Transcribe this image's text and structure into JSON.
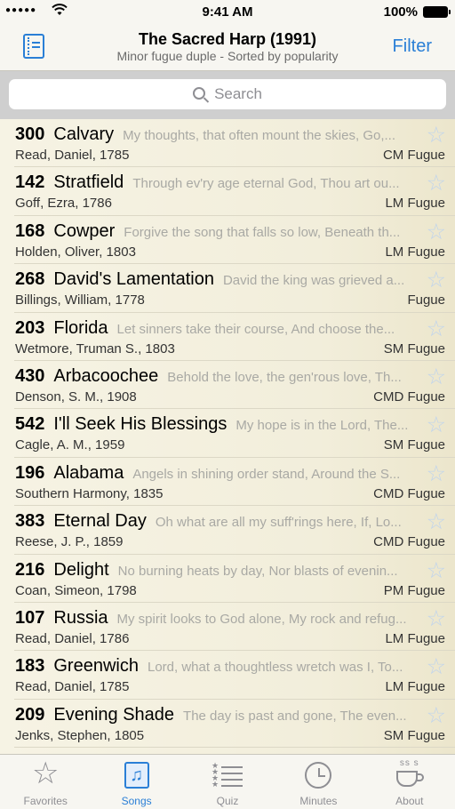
{
  "status": {
    "time": "9:41 AM",
    "battery": "100%"
  },
  "nav": {
    "title": "The Sacred Harp (1991)",
    "subtitle": "Minor fugue duple  - Sorted by popularity",
    "filter_label": "Filter"
  },
  "search": {
    "placeholder": "Search"
  },
  "songs": [
    {
      "num": "300",
      "name": "Calvary",
      "lyric": "My thoughts, that often mount the skies, Go,...",
      "composer": "Read, Daniel, 1785",
      "meter": "CM Fugue"
    },
    {
      "num": "142",
      "name": "Stratfield",
      "lyric": "Through ev'ry age eternal God, Thou art ou...",
      "composer": "Goff, Ezra, 1786",
      "meter": "LM Fugue"
    },
    {
      "num": "168",
      "name": "Cowper",
      "lyric": "Forgive the song that falls so low, Beneath th...",
      "composer": "Holden, Oliver, 1803",
      "meter": "LM Fugue"
    },
    {
      "num": "268",
      "name": "David's Lamentation",
      "lyric": "David the king was grieved a...",
      "composer": "Billings, William, 1778",
      "meter": "Fugue"
    },
    {
      "num": "203",
      "name": "Florida",
      "lyric": "Let sinners take their course, And choose the...",
      "composer": "Wetmore, Truman S., 1803",
      "meter": "SM Fugue"
    },
    {
      "num": "430",
      "name": "Arbacoochee",
      "lyric": "Behold the love, the gen'rous love, Th...",
      "composer": "Denson, S. M., 1908",
      "meter": "CMD Fugue"
    },
    {
      "num": "542",
      "name": "I'll Seek His Blessings",
      "lyric": "My hope is in the Lord, The...",
      "composer": "Cagle, A. M., 1959",
      "meter": "SM Fugue"
    },
    {
      "num": "196",
      "name": "Alabama",
      "lyric": "Angels in shining order stand, Around the S...",
      "composer": "Southern Harmony, 1835",
      "meter": "CMD Fugue"
    },
    {
      "num": "383",
      "name": "Eternal Day",
      "lyric": "Oh what are all my suff'rings here, If, Lo...",
      "composer": "Reese, J. P., 1859",
      "meter": "CMD Fugue"
    },
    {
      "num": "216",
      "name": "Delight",
      "lyric": "No burning heats by day, Nor blasts of evenin...",
      "composer": "Coan, Simeon, 1798",
      "meter": "PM Fugue"
    },
    {
      "num": "107",
      "name": "Russia",
      "lyric": "My spirit looks to God alone, My rock and refug...",
      "composer": "Read, Daniel, 1786",
      "meter": "LM Fugue"
    },
    {
      "num": "183",
      "name": "Greenwich",
      "lyric": "Lord, what a thoughtless wretch was I, To...",
      "composer": "Read, Daniel, 1785",
      "meter": "LM Fugue"
    },
    {
      "num": "209",
      "name": "Evening Shade",
      "lyric": "The day is past and gone, The even...",
      "composer": "Jenks, Stephen, 1805",
      "meter": "SM Fugue"
    }
  ],
  "tabs": [
    {
      "label": "Favorites",
      "icon": "star-icon"
    },
    {
      "label": "Songs",
      "icon": "songs-icon"
    },
    {
      "label": "Quiz",
      "icon": "quiz-icon"
    },
    {
      "label": "Minutes",
      "icon": "clock-icon"
    },
    {
      "label": "About",
      "icon": "coffee-cup-icon"
    }
  ],
  "colors": {
    "accent": "#2a7fd6",
    "star_outline": "#c0d4ec",
    "inactive_tab": "#8e8e93"
  }
}
